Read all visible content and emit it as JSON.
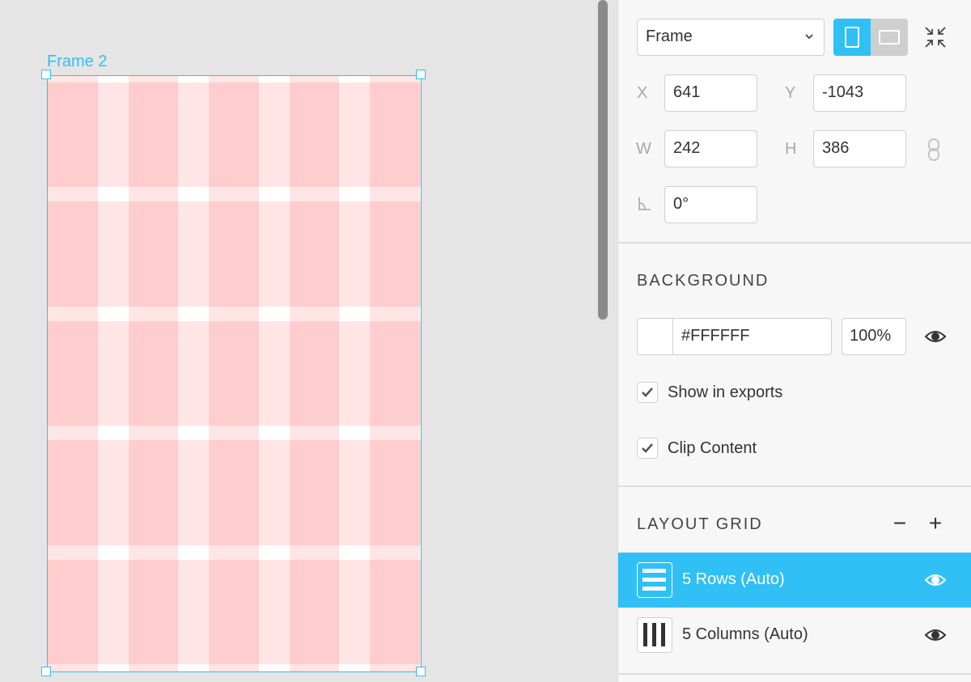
{
  "canvas": {
    "frame_label": "Frame 2",
    "frame_background": "#FFFFFF",
    "grid_color": "#FF0000",
    "grid_rows": 5,
    "grid_columns": 5
  },
  "inspector": {
    "frame_type": {
      "value": "Frame",
      "icon": "chevron-down-icon"
    },
    "orientation": {
      "options": [
        "portrait",
        "landscape"
      ],
      "selected": "portrait"
    },
    "position": {
      "x_label": "X",
      "x_value": "641",
      "y_label": "Y",
      "y_value": "-1043",
      "w_label": "W",
      "w_value": "242",
      "h_label": "H",
      "h_value": "386",
      "rotation_value": "0°"
    },
    "background": {
      "title": "BACKGROUND",
      "hex": "#FFFFFF",
      "opacity": "100%",
      "swatch_color": "#FFFFFF",
      "show_in_exports": {
        "label": "Show in exports",
        "checked": true
      },
      "clip_content": {
        "label": "Clip Content",
        "checked": true
      }
    },
    "layout_grid": {
      "title": "LAYOUT GRID",
      "remove_label": "−",
      "add_label": "+",
      "items": [
        {
          "label": "5 Rows (Auto)",
          "type": "rows",
          "selected": true
        },
        {
          "label": "5 Columns (Auto)",
          "type": "columns",
          "selected": false
        }
      ]
    }
  },
  "colors": {
    "accent": "#30C0F5",
    "panel_bg": "#F7F7F7",
    "canvas_bg": "#E5E5E5"
  }
}
